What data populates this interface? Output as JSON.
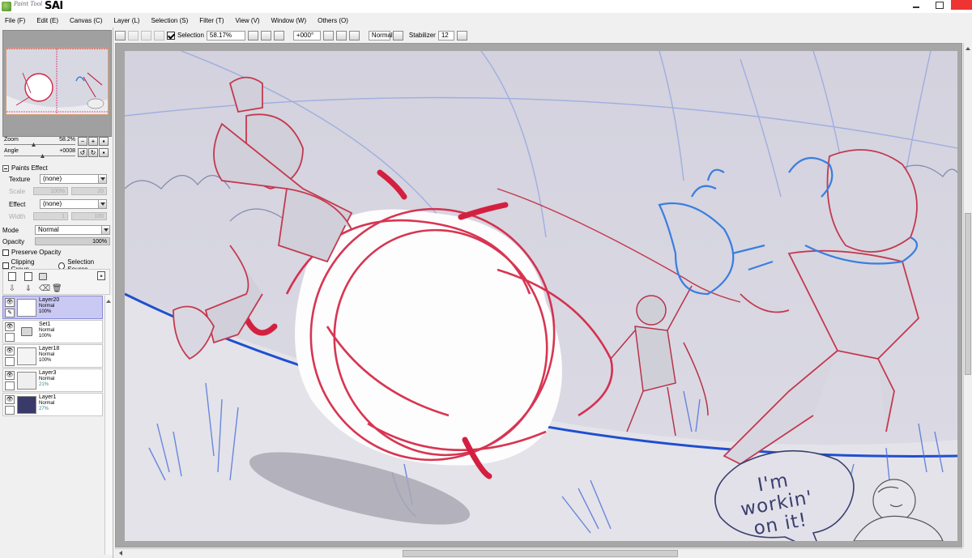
{
  "app": {
    "logo_small": "Paint Tool",
    "logo_big": "SAI"
  },
  "menu": [
    "File (F)",
    "Edit (E)",
    "Canvas (C)",
    "Layer (L)",
    "Selection (S)",
    "Filter (T)",
    "View (V)",
    "Window (W)",
    "Others (O)"
  ],
  "toolbar": {
    "selection_label": "Selection",
    "zoom_value": "58.17%",
    "angle_value": "+000°",
    "blend_value": "Normal",
    "stabilizer_label": "Stabilizer",
    "stabilizer_value": "12"
  },
  "navigator": {
    "zoom_label": "Zoom",
    "zoom_value": "58.2%",
    "angle_label": "Angle",
    "angle_value": "+0008"
  },
  "paints_effect": {
    "title": "Paints Effect",
    "texture_label": "Texture",
    "texture_value": "(none)",
    "scale_label": "Scale",
    "scale_value": "100%",
    "scale_num": "20",
    "effect_label": "Effect",
    "effect_value": "(none)",
    "width_label": "Width",
    "width_value": "1",
    "width_num": "100"
  },
  "layer_props": {
    "mode_label": "Mode",
    "mode_value": "Normal",
    "opacity_label": "Opacity",
    "opacity_value": "100%",
    "preserve_opacity": "Preserve Opacity",
    "clipping_group": "Clipping Group",
    "selection_source": "Selection Source"
  },
  "layers": [
    {
      "name": "Layer20",
      "mode": "Normal",
      "opacity": "100%",
      "selected": true,
      "type": "layer",
      "thumb": "#ffffff"
    },
    {
      "name": "Set1",
      "mode": "Normal",
      "opacity": "100%",
      "selected": false,
      "type": "folder",
      "thumb": "#ffffff"
    },
    {
      "name": "Layer18",
      "mode": "Normal",
      "opacity": "100%",
      "selected": false,
      "type": "layer",
      "thumb": "#f4f4f4"
    },
    {
      "name": "Layer3",
      "mode": "Normal",
      "opacity": "21%",
      "selected": false,
      "type": "layer",
      "thumb": "#efefef"
    },
    {
      "name": "Layer1",
      "mode": "Normal",
      "opacity": "27%",
      "selected": false,
      "type": "layer",
      "thumb": "#3a3a6a"
    }
  ],
  "canvas": {
    "bubble_text_1": "I'm workin'",
    "bubble_text_2": "on it!"
  },
  "colors": {
    "sketch_red": "#d42040",
    "sketch_blue": "#3a7ee0",
    "ground_line": "#1f4fd0",
    "background": "#d7d6e0"
  }
}
